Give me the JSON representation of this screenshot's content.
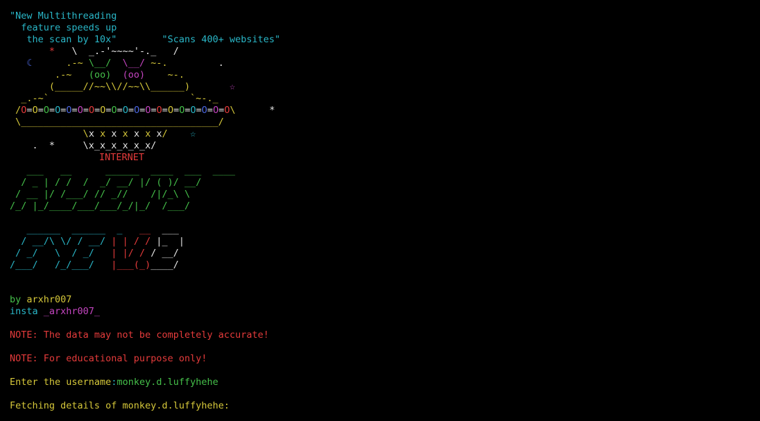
{
  "tagline": {
    "line1": "\"New Multithreading",
    "line2": "  feature speeds up",
    "line3": "   the scan by 10x\"",
    "scans": "\"Scans 400+ websites\""
  },
  "art": {
    "internet_label": "INTERNET"
  },
  "credits": {
    "by_prefix": "by ",
    "by_name": "arxhr007",
    "insta_prefix": "insta ",
    "insta_handle": "_arxhr007_"
  },
  "notes": [
    "NOTE: The data may not be completely accurate!",
    "NOTE: For educational purpose only!"
  ],
  "prompt": {
    "label": "Enter the username",
    "separator": ":",
    "value": "monkey.d.luffyhehe"
  },
  "status": "Fetching details of monkey.d.luffyhehe:",
  "colors": {
    "background": "#000000",
    "cyan": "#2ab7c8",
    "red": "#e53b3b",
    "yellow": "#d6c83a",
    "green": "#45c04a",
    "magenta": "#c445c0",
    "blue": "#4b67e0"
  }
}
